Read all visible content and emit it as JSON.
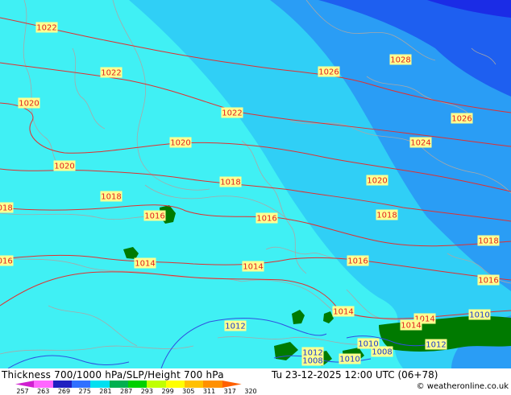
{
  "footer": {
    "title": "Thickness 700/1000 hPa/SLP/Height 700 hPa",
    "datetime": "Tu 23-12-2025 12:00 UTC (06+78)",
    "credit": "© weatheronline.co.uk"
  },
  "legend": {
    "ticks": [
      "257",
      "263",
      "269",
      "275",
      "281",
      "287",
      "293",
      "299",
      "305",
      "311",
      "317",
      "320"
    ],
    "colors": [
      "#d020d0",
      "#ff66ff",
      "#2020c0",
      "#3070ff",
      "#00e0f0",
      "#00b050",
      "#00d000",
      "#c0ff00",
      "#ffff00",
      "#ffc000",
      "#ff9000",
      "#ff6000"
    ]
  },
  "colors": {
    "cyan": "#40f0f4",
    "sky": "#30cff6",
    "blue": "#2a9df5",
    "deep_blue": "#1e5ff0",
    "navy": "#1b2ce6",
    "green": "#007a00",
    "isobar": "#e03030",
    "label_fill": "#ffff90",
    "border": "#a8a8a8"
  },
  "isobars": [
    {
      "label": "1022",
      "tone": "red"
    },
    {
      "label": "1022",
      "tone": "red"
    },
    {
      "label": "1022",
      "tone": "red"
    },
    {
      "label": "1020",
      "tone": "red"
    },
    {
      "label": "1020",
      "tone": "red"
    },
    {
      "label": "1020",
      "tone": "red"
    },
    {
      "label": "1020",
      "tone": "red"
    },
    {
      "label": "1018",
      "tone": "red"
    },
    {
      "label": "1018",
      "tone": "red"
    },
    {
      "label": "1018",
      "tone": "red"
    },
    {
      "label": "1018",
      "tone": "red"
    },
    {
      "label": "1016",
      "tone": "red"
    },
    {
      "label": "1016",
      "tone": "red"
    },
    {
      "label": "1016",
      "tone": "red"
    },
    {
      "label": "1016",
      "tone": "red"
    },
    {
      "label": "1014",
      "tone": "red"
    },
    {
      "label": "1014",
      "tone": "red"
    },
    {
      "label": "1014",
      "tone": "red"
    },
    {
      "label": "1014",
      "tone": "red"
    },
    {
      "label": "1014",
      "tone": "red"
    },
    {
      "label": "1012",
      "tone": "blue"
    },
    {
      "label": "1012",
      "tone": "blue"
    },
    {
      "label": "1012",
      "tone": "blue"
    },
    {
      "label": "1010",
      "tone": "blue"
    },
    {
      "label": "1010",
      "tone": "blue"
    },
    {
      "label": "1010",
      "tone": "blue"
    },
    {
      "label": "1008",
      "tone": "blue"
    },
    {
      "label": "1008",
      "tone": "blue"
    },
    {
      "label": "1024",
      "tone": "red"
    },
    {
      "label": "1026",
      "tone": "red"
    },
    {
      "label": "1026",
      "tone": "red"
    },
    {
      "label": "1028",
      "tone": "red"
    },
    {
      "label": "1016",
      "tone": "red"
    },
    {
      "label": "1018",
      "tone": "red"
    }
  ]
}
